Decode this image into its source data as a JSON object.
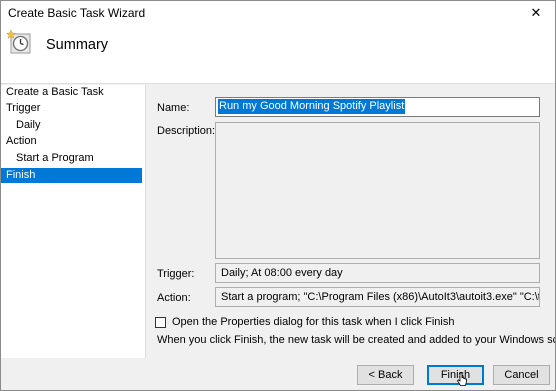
{
  "window": {
    "title": "Create Basic Task Wizard",
    "close_glyph": "✕"
  },
  "header": {
    "title": "Summary",
    "icon": "task-clock-icon"
  },
  "sidebar": {
    "items": [
      {
        "label": "Create a Basic Task"
      },
      {
        "label": "Trigger"
      },
      {
        "label": "Daily"
      },
      {
        "label": "Action"
      },
      {
        "label": "Start a Program"
      },
      {
        "label": "Finish"
      }
    ]
  },
  "summary": {
    "name_label": "Name:",
    "name_value": "Run my Good Morning Spotify Playlist",
    "description_label": "Description:",
    "description_value": "",
    "trigger_label": "Trigger:",
    "trigger_value": "Daily; At 08:00 every day",
    "action_label": "Action:",
    "action_value": "Start a program; \"C:\\Program Files (x86)\\AutoIt3\\autoit3.exe\" \"C:\\temp\\RunSpoti"
  },
  "options": {
    "open_properties_label": "Open the Properties dialog for this task when I click Finish",
    "open_properties_checked": false,
    "info_text": "When you click Finish, the new task will be created and added to your Windows schedule."
  },
  "buttons": {
    "back": "< Back",
    "finish": "Finish",
    "cancel": "Cancel"
  },
  "colors": {
    "accent": "#0078d7",
    "window_bg": "#f0f0f0"
  }
}
